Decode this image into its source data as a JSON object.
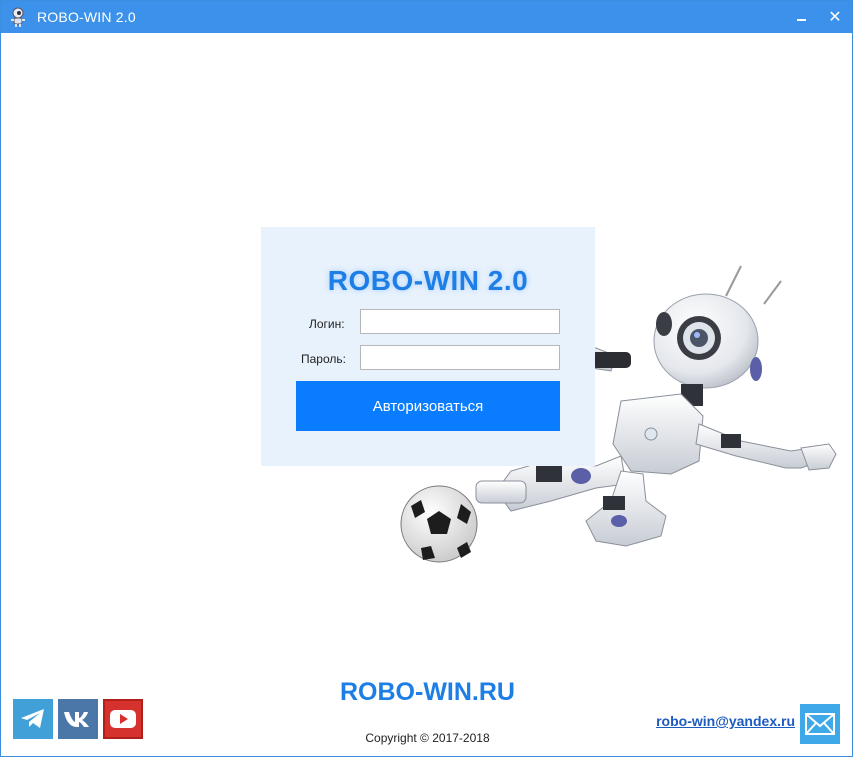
{
  "window": {
    "title": "ROBO-WIN 2.0",
    "accent_color": "#3c92ea",
    "icons": {
      "app": "robot-icon",
      "minimize": "minimize-icon",
      "close": "close-icon"
    },
    "close_glyph": "✕"
  },
  "login": {
    "title": "ROBO-WIN 2.0",
    "login_label": "Логин:",
    "login_value": "",
    "password_label": "Пароль:",
    "password_value": "",
    "submit_label": "Авторизоваться",
    "button_color": "#0a7cff",
    "title_color": "#1d7fe6"
  },
  "footer": {
    "site": "ROBO-WIN.RU",
    "copyright": "Copyright © 2017-2018",
    "email": "robo-win@yandex.ru",
    "social": [
      {
        "name": "telegram-icon",
        "color": "#41a0d8"
      },
      {
        "name": "vk-icon",
        "color": "#4a76a8"
      },
      {
        "name": "youtube-icon",
        "color": "#d6322d"
      }
    ],
    "mail_icon": "mail-icon"
  },
  "illustration": {
    "subject": "robot-kicking-soccer-ball-illustration"
  }
}
